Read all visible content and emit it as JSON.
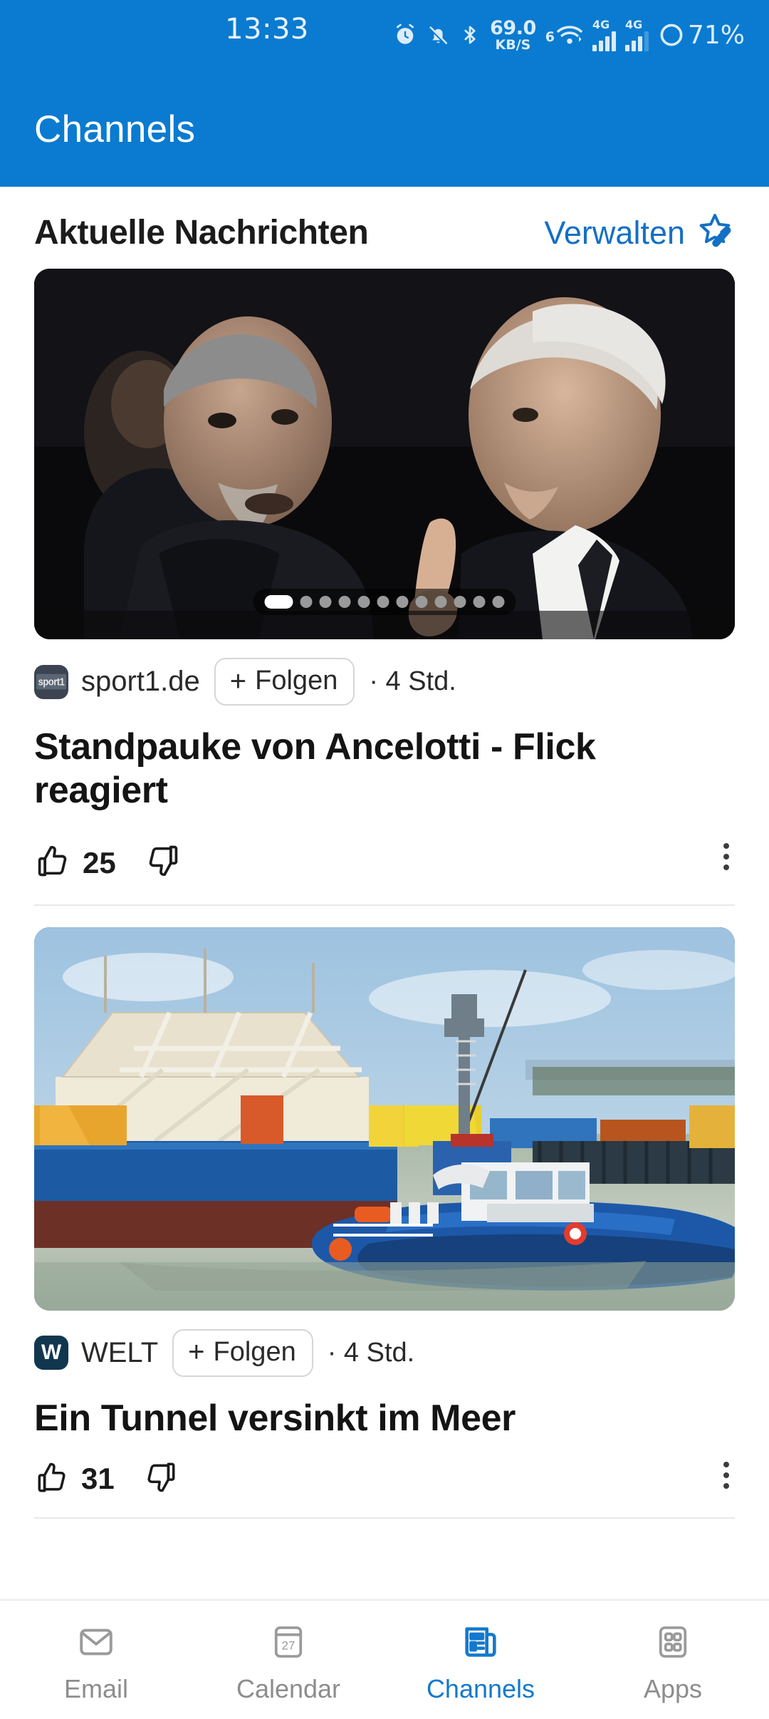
{
  "theme": {
    "header_blue": "#0a7bd0",
    "accent_blue": "#1479cd",
    "link_blue": "#1470c4",
    "text_dark": "#141414",
    "text_muted": "#8d8d8d"
  },
  "status_bar": {
    "time": "13:33",
    "network_speed_value": "69.0",
    "network_speed_unit": "KB/S",
    "wifi_generation": "6",
    "sim1_network": "4G",
    "sim2_network": "4G",
    "battery_percent": "71%",
    "icons": [
      "alarm-clock-icon",
      "bell-muted-icon",
      "bluetooth-icon",
      "wifi-icon",
      "signal-icon",
      "signal-icon",
      "battery-icon"
    ]
  },
  "app_bar": {
    "title": "Channels"
  },
  "section": {
    "title": "Aktuelle Nachrichten",
    "manage_label": "Verwalten",
    "manage_icon": "star-edit-icon"
  },
  "articles": [
    {
      "image_alt": "Zwei Fussballtrainer im Gespraech am Spielfeldrand",
      "carousel": {
        "total": 12,
        "active_index": 0
      },
      "source": "sport1.de",
      "source_initial": "sport1",
      "follow_label": "Folgen",
      "follow_plus": "+",
      "age": "· 4 Std.",
      "headline": "Standpauke von Ancelotti - Flick reagiert",
      "likes": "25",
      "like_icon": "thumbs-up-icon",
      "dislike_icon": "thumbs-down-icon",
      "menu_icon": "kebab-menu-icon"
    },
    {
      "image_alt": "Blauer Schlepper in einem Hafen mit Kraenen",
      "source": "WELT",
      "source_initial": "W",
      "follow_label": "Folgen",
      "follow_plus": "+",
      "age": "· 4 Std.",
      "headline": "Ein Tunnel versinkt im Meer",
      "likes": "31",
      "like_icon": "thumbs-up-icon",
      "dislike_icon": "thumbs-down-icon",
      "menu_icon": "kebab-menu-icon"
    }
  ],
  "bottom_nav": {
    "items": [
      {
        "label": "Email",
        "icon": "envelope-icon",
        "active": false
      },
      {
        "label": "Calendar",
        "icon": "calendar-icon",
        "day": "27",
        "active": false
      },
      {
        "label": "Channels",
        "icon": "newspaper-icon",
        "active": true
      },
      {
        "label": "Apps",
        "icon": "grid-apps-icon",
        "active": false
      }
    ]
  }
}
